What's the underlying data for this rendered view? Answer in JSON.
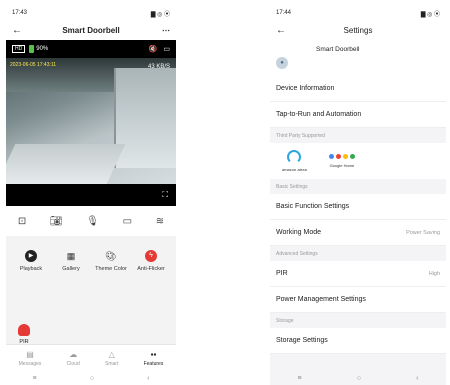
{
  "left": {
    "status": {
      "time": "17:43",
      "icons": "▇ ◎ ⦿"
    },
    "appbar": {
      "title": "Smart Doorbell",
      "more": "⋯",
      "back": "←"
    },
    "camera": {
      "hd": "HD",
      "battery": "90%",
      "bitrate": "43 KB/S",
      "timestamp": "2023-06-05 17:43:11"
    },
    "features": [
      {
        "label": "Playback",
        "icon": "play-icon"
      },
      {
        "label": "Gallery",
        "icon": "gallery-icon"
      },
      {
        "label": "Theme Color",
        "icon": "palette-icon"
      },
      {
        "label": "Anti-Flicker",
        "icon": "flash-icon"
      }
    ],
    "pir_label": "PIR",
    "tabs": [
      {
        "label": "Messages",
        "icon": "messages-icon"
      },
      {
        "label": "Cloud",
        "icon": "cloud-icon"
      },
      {
        "label": "Smart",
        "icon": "smart-icon"
      },
      {
        "label": "Features",
        "icon": "features-icon"
      }
    ]
  },
  "right": {
    "status": {
      "time": "17:44",
      "icons": "▇ ◎ ⦿"
    },
    "appbar": {
      "title": "Settings",
      "back": "←"
    },
    "device_name": "Smart Doorbell",
    "rows_top": [
      "Device Information",
      "Tap-to-Run and Automation"
    ],
    "sections": {
      "third_party": "Third Party Supported",
      "basic": "Basic Settings",
      "advanced": "Advanced Settings",
      "storage": "Storage"
    },
    "third_party": [
      {
        "label": "amazon alexa"
      },
      {
        "label": "Google Home"
      }
    ],
    "basic_rows": [
      {
        "label": "Basic Function Settings",
        "value": ""
      },
      {
        "label": "Working Mode",
        "value": "Power Saving"
      }
    ],
    "advanced_rows": [
      {
        "label": "PIR",
        "value": "High"
      },
      {
        "label": "Power Management Settings",
        "value": ""
      }
    ],
    "storage_rows": [
      {
        "label": "Storage Settings",
        "value": ""
      }
    ]
  },
  "colors": {
    "accent_red": "#e53935",
    "alexa_blue": "#2ea7e0"
  }
}
